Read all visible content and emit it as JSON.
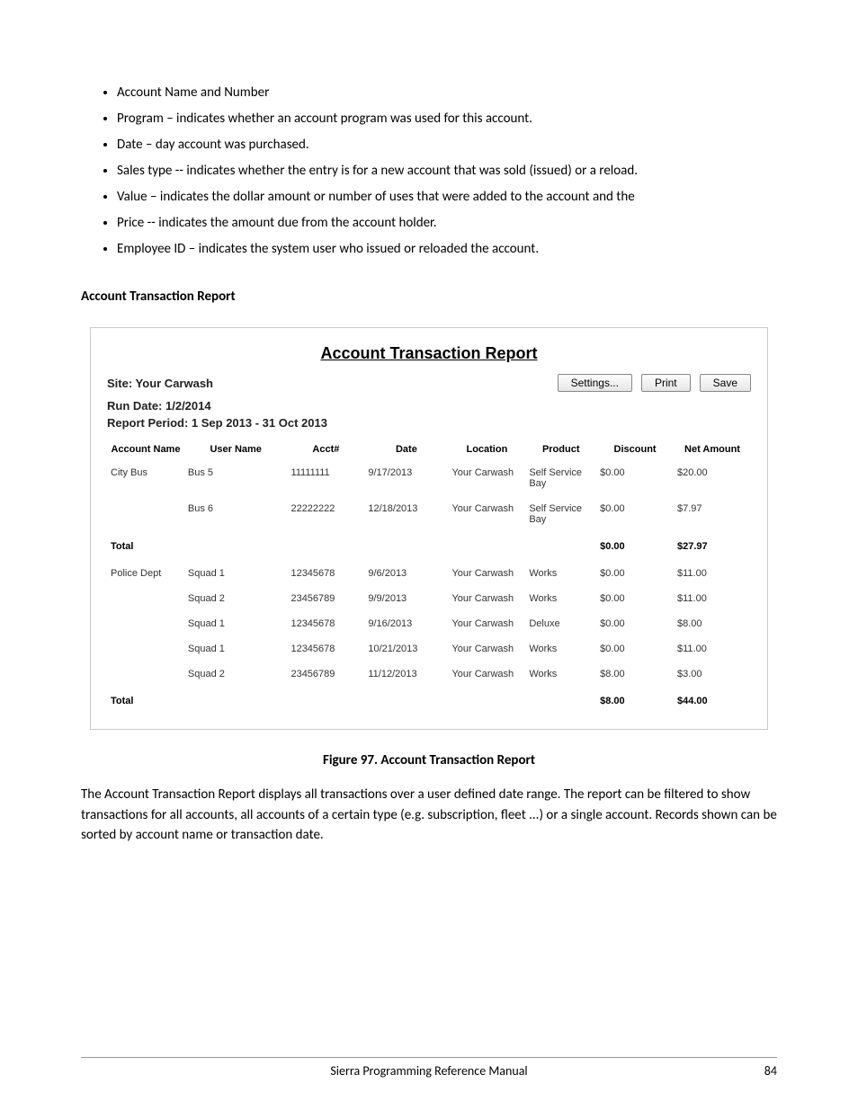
{
  "bullets": [
    "Account Name and Number",
    "Program – indicates whether an account program was used for this account.",
    "Date – day account was purchased.",
    "Sales type -- indicates whether the entry is for a new account that was sold  (issued) or a reload.",
    "Value – indicates the dollar amount or number of uses that were added to the account and the",
    "Price -- indicates the amount due from the account holder.",
    "Employee ID – indicates the system user who issued or reloaded the account."
  ],
  "section_heading": "Account Transaction Report",
  "report": {
    "title": "Account Transaction Report",
    "site_line": "Site: Your Carwash",
    "run_date_line": "Run Date: 1/2/2014",
    "period_line": "Report Period: 1 Sep 2013 - 31 Oct 2013",
    "buttons": {
      "settings": "Settings...",
      "print": "Print",
      "save": "Save"
    },
    "headers": {
      "account_name": "Account Name",
      "user_name": "User Name",
      "acct": "Acct#",
      "date": "Date",
      "location": "Location",
      "product": "Product",
      "discount": "Discount",
      "net_amount": "Net Amount"
    },
    "rows": [
      {
        "account_name": "City Bus",
        "user": "Bus 5",
        "acct": "11111111",
        "date": "9/17/2013",
        "location": "Your Carwash",
        "product": "Self Service Bay",
        "discount": "$0.00",
        "net": "$20.00",
        "total": false
      },
      {
        "account_name": "",
        "user": "Bus 6",
        "acct": "22222222",
        "date": "12/18/2013",
        "location": "Your Carwash",
        "product": "Self Service Bay",
        "discount": "$0.00",
        "net": "$7.97",
        "total": false
      },
      {
        "account_name": "Total",
        "user": "",
        "acct": "",
        "date": "",
        "location": "",
        "product": "",
        "discount": "$0.00",
        "net": "$27.97",
        "total": true
      },
      {
        "account_name": "Police Dept",
        "user": "Squad 1",
        "acct": "12345678",
        "date": "9/6/2013",
        "location": "Your Carwash",
        "product": "Works",
        "discount": "$0.00",
        "net": "$11.00",
        "total": false
      },
      {
        "account_name": "",
        "user": "Squad 2",
        "acct": "23456789",
        "date": "9/9/2013",
        "location": "Your Carwash",
        "product": "Works",
        "discount": "$0.00",
        "net": "$11.00",
        "total": false
      },
      {
        "account_name": "",
        "user": "Squad 1",
        "acct": "12345678",
        "date": "9/16/2013",
        "location": "Your Carwash",
        "product": "Deluxe",
        "discount": "$0.00",
        "net": "$8.00",
        "total": false
      },
      {
        "account_name": "",
        "user": "Squad 1",
        "acct": "12345678",
        "date": "10/21/2013",
        "location": "Your Carwash",
        "product": "Works",
        "discount": "$0.00",
        "net": "$11.00",
        "total": false
      },
      {
        "account_name": "",
        "user": "Squad 2",
        "acct": "23456789",
        "date": "11/12/2013",
        "location": "Your Carwash",
        "product": "Works",
        "discount": "$8.00",
        "net": "$3.00",
        "total": false
      },
      {
        "account_name": "Total",
        "user": "",
        "acct": "",
        "date": "",
        "location": "",
        "product": "",
        "discount": "$8.00",
        "net": "$44.00",
        "total": true
      }
    ]
  },
  "figure_caption": "Figure 97. Account Transaction Report",
  "body_paragraph": "The Account Transaction Report displays all transactions over a user defined date range.  The report can be filtered to show transactions for all accounts, all accounts of a certain type (e.g. subscription, fleet ...) or a single account.  Records shown can be sorted by account name or transaction date.",
  "footer": {
    "title": "Sierra Programming Reference Manual",
    "page": "84"
  }
}
